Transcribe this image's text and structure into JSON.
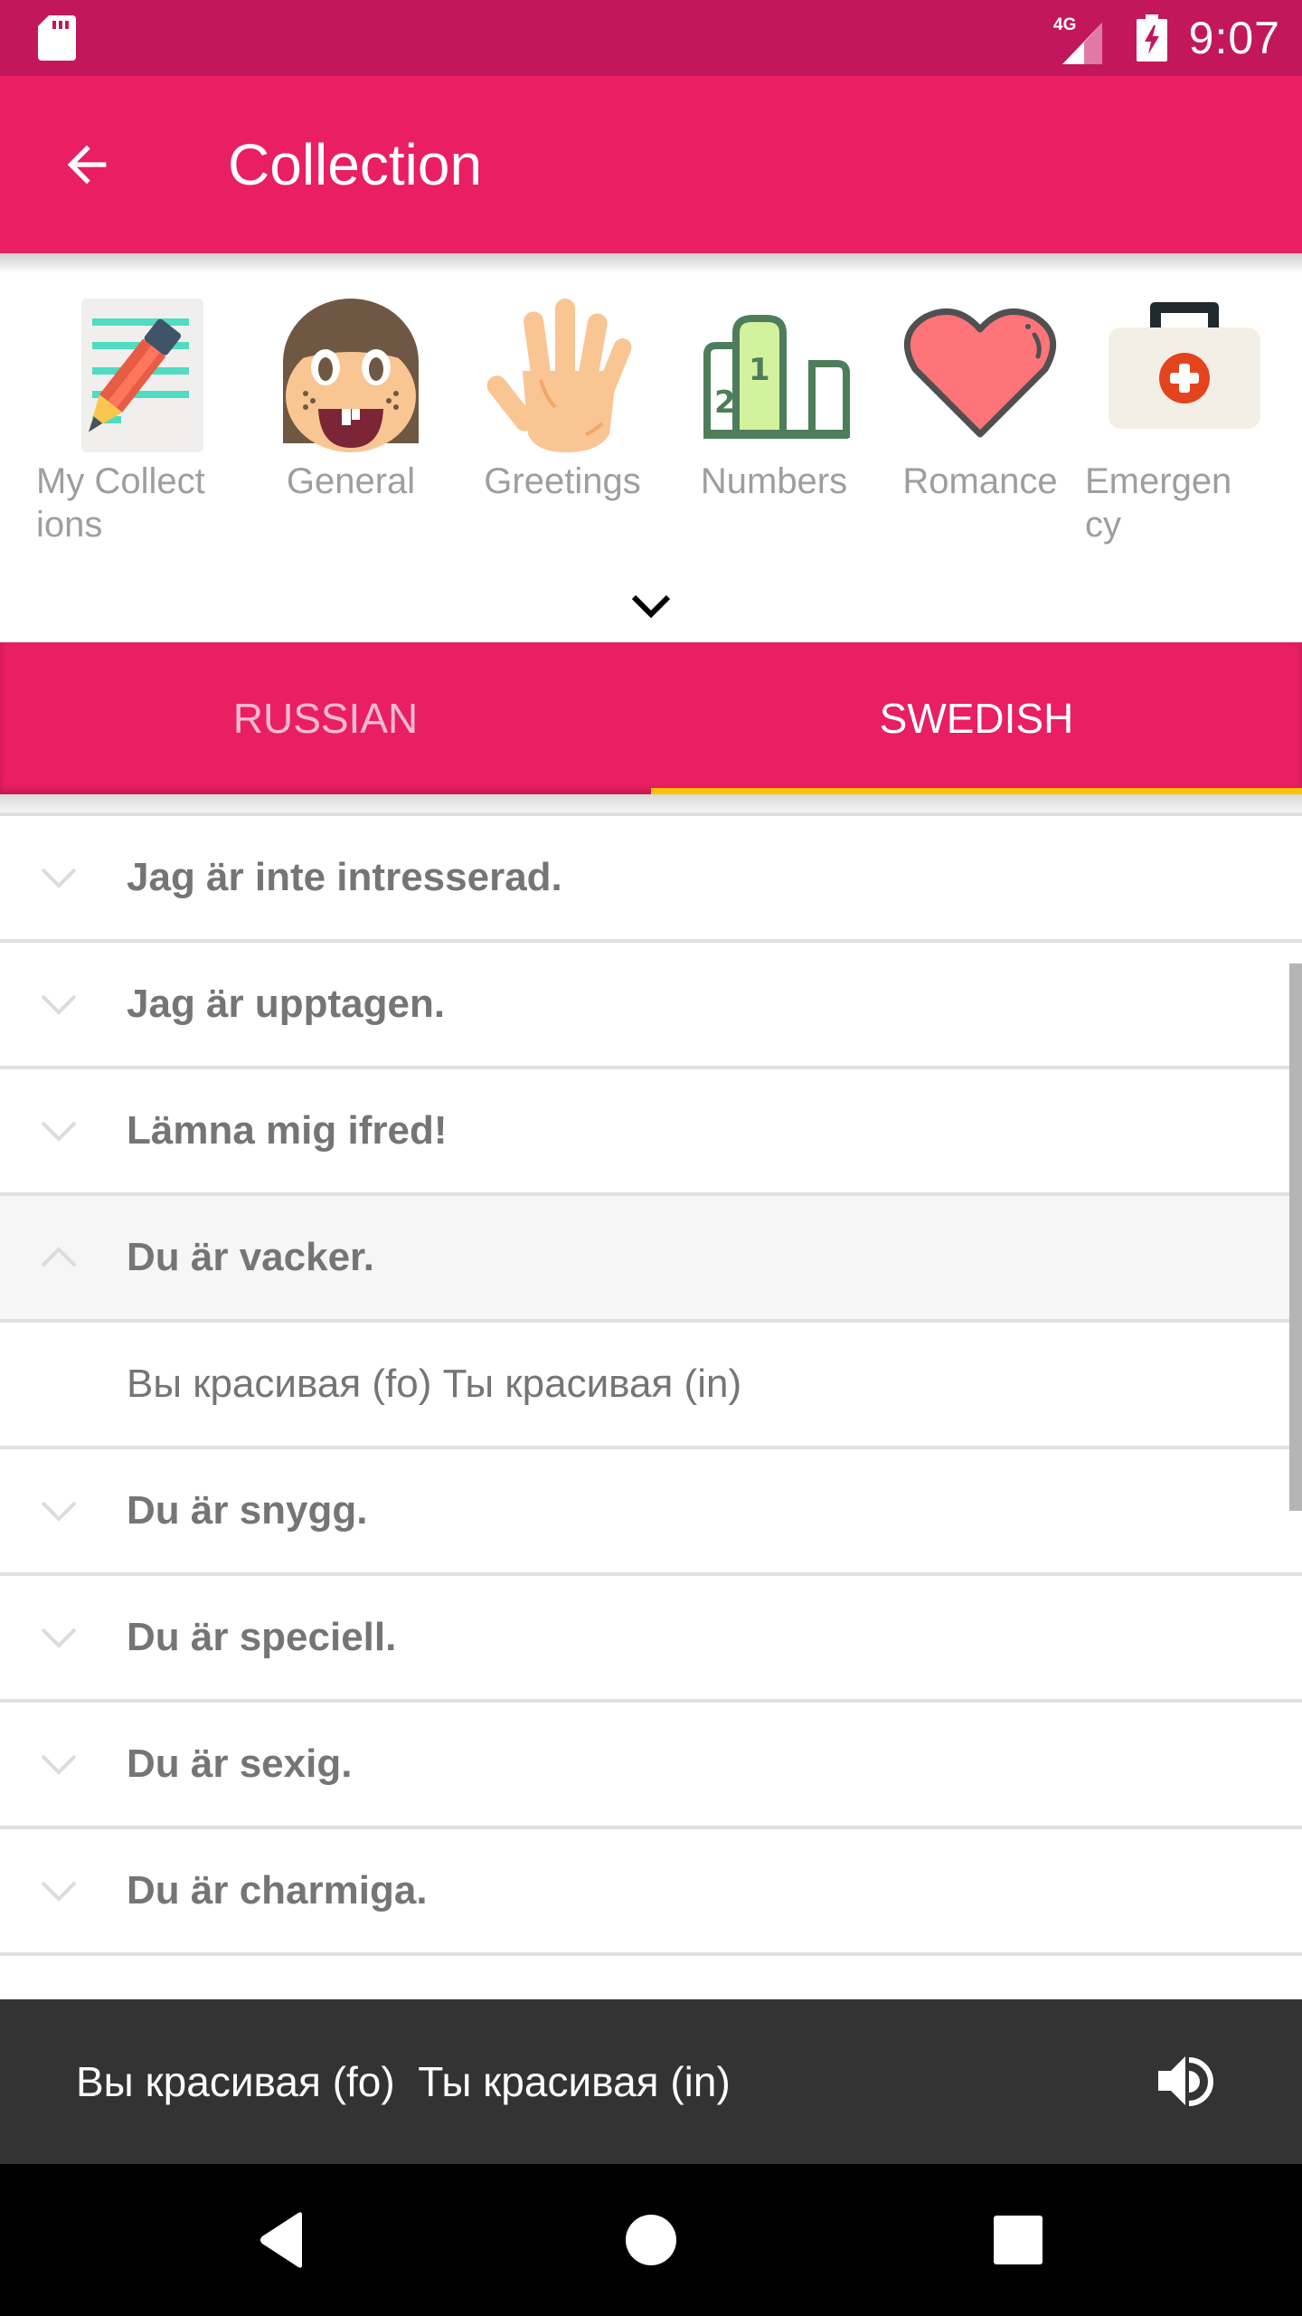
{
  "status_bar": {
    "time": "9:07",
    "network": "4G",
    "icons": [
      "sd-card-icon",
      "signal-4g-icon",
      "battery-charging-icon"
    ]
  },
  "toolbar": {
    "title": "Collection",
    "back_icon": "arrow-left-icon"
  },
  "categories": {
    "items": [
      {
        "label": "My Collect ions",
        "icon": "notepad-pencil-icon"
      },
      {
        "label": "General",
        "icon": "girl-face-icon"
      },
      {
        "label": "Greetings",
        "icon": "waving-hand-icon"
      },
      {
        "label": "Numbers",
        "icon": "podium-icon"
      },
      {
        "label": "Romance",
        "icon": "heart-icon"
      },
      {
        "label": "Emergen cy",
        "icon": "first-aid-kit-icon"
      }
    ],
    "expand_icon": "chevron-down-icon"
  },
  "tabs": {
    "items": [
      {
        "label": "RUSSIAN",
        "active": false
      },
      {
        "label": "SWEDISH",
        "active": true
      }
    ],
    "indicator_color": "#ffc107"
  },
  "phrases": {
    "rows": [
      {
        "text": "Jag är inte intresserad.",
        "expanded": false
      },
      {
        "text": "Jag är upptagen.",
        "expanded": false
      },
      {
        "text": "Lämna mig ifred!",
        "expanded": false
      },
      {
        "text": "Du är vacker.",
        "expanded": true,
        "translation": "Вы красивая (fo)  Ты красивая (in)"
      },
      {
        "text": "Du är snygg.",
        "expanded": false
      },
      {
        "text": "Du är speciell.",
        "expanded": false
      },
      {
        "text": "Du är sexig.",
        "expanded": false
      },
      {
        "text": "Du är charmiga.",
        "expanded": false
      }
    ]
  },
  "snackbar": {
    "text": "Вы красивая (fo)  Ты красивая (in)",
    "action_icon": "speaker-icon"
  },
  "navbar": {
    "buttons": [
      "back-triangle-icon",
      "home-circle-icon",
      "recents-square-icon"
    ]
  },
  "colors": {
    "primary": "#e91e63",
    "primary_dark": "#c2185b",
    "accent": "#ffc107",
    "snackbar": "#333333"
  }
}
